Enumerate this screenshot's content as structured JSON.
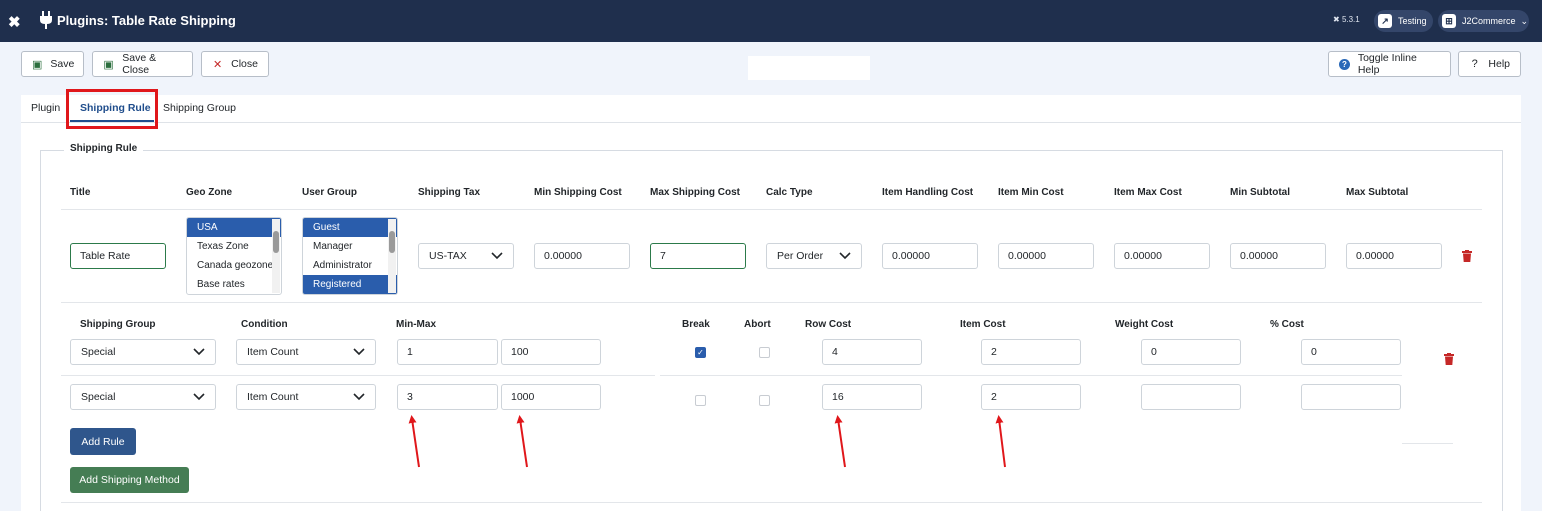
{
  "header": {
    "title": "Plugins: Table Rate Shipping",
    "version": "5.3.1",
    "site_label": "Testing",
    "user_menu_label": "J2Commerce"
  },
  "toolbar": {
    "save": "Save",
    "save_close": "Save & Close",
    "close": "Close",
    "toggle_help": "Toggle Inline Help",
    "help": "Help"
  },
  "tabs": [
    "Plugin",
    "Shipping Rule",
    "Shipping Group"
  ],
  "section": {
    "legend": "Shipping Rule"
  },
  "rule_headers": [
    "Title",
    "Geo Zone",
    "User Group",
    "Shipping Tax",
    "Min Shipping Cost",
    "Max Shipping Cost",
    "Calc Type",
    "Item Handling Cost",
    "Item Min Cost",
    "Item Max Cost",
    "Min Subtotal",
    "Max Subtotal"
  ],
  "rule": {
    "title": "Table Rate",
    "geo_zones": [
      {
        "label": "USA",
        "selected": true
      },
      {
        "label": "Texas Zone",
        "selected": false
      },
      {
        "label": "Canada geozone",
        "selected": false
      },
      {
        "label": "Base rates",
        "selected": false
      }
    ],
    "user_groups": [
      {
        "label": "Guest",
        "selected": true
      },
      {
        "label": "Manager",
        "selected": false
      },
      {
        "label": "Administrator",
        "selected": false
      },
      {
        "label": "Registered",
        "selected": true
      }
    ],
    "shipping_tax": "US-TAX",
    "min_shipping_cost": "0.00000",
    "max_shipping_cost": "7",
    "calc_type": "Per Order",
    "item_handling_cost": "0.00000",
    "item_min_cost": "0.00000",
    "item_max_cost": "0.00000",
    "min_subtotal": "0.00000",
    "max_subtotal": "0.00000"
  },
  "sub_headers": [
    "Shipping Group",
    "Condition",
    "Min-Max",
    "Break",
    "Abort",
    "Row Cost",
    "Item Cost",
    "Weight Cost",
    "% Cost"
  ],
  "sub_rules": [
    {
      "group": "Special",
      "condition": "Item Count",
      "min": "1",
      "max": "100",
      "break": true,
      "abort": false,
      "row_cost": "4",
      "item_cost": "2",
      "weight_cost": "0",
      "pct_cost": "0"
    },
    {
      "group": "Special",
      "condition": "Item Count",
      "min": "3",
      "max": "1000",
      "break": false,
      "abort": false,
      "row_cost": "16",
      "item_cost": "2",
      "weight_cost": "",
      "pct_cost": ""
    }
  ],
  "buttons": {
    "add_rule": "Add Rule",
    "add_shipping_method": "Add Shipping Method"
  },
  "colors": {
    "header_bg": "#1f2f4d",
    "accent_blue": "#2a5dac",
    "green": "#457d54",
    "danger": "#c52827",
    "annotation_red": "#e0171b"
  }
}
